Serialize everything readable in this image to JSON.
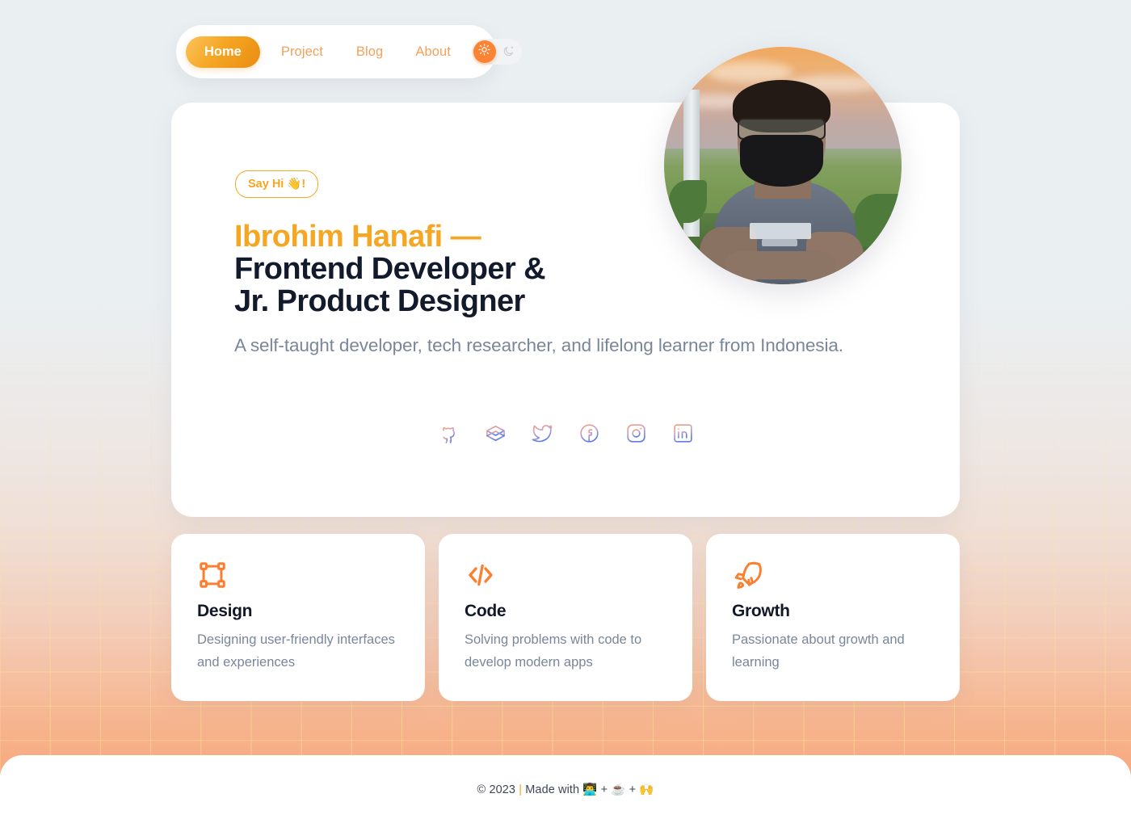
{
  "theme": {
    "accent_orange": "#f5a623",
    "accent_deep_orange": "#fb7f2e",
    "heading_dark": "#121a2b",
    "muted_text": "#7a8699",
    "card_white": "#ffffff",
    "bg_top": "#eaeff2",
    "bg_bottom": "#f9a173"
  },
  "nav": {
    "items": [
      {
        "label": "Home",
        "active": true
      },
      {
        "label": "Project",
        "active": false
      },
      {
        "label": "Blog",
        "active": false
      },
      {
        "label": "About",
        "active": false
      }
    ],
    "theme_toggle": {
      "state": "light",
      "light_icon": "sun-icon",
      "dark_icon": "moon-icon"
    }
  },
  "hero": {
    "badge": "Say Hi 👋!",
    "name": "Ibrohim Hanafi —",
    "role_line_1": "Frontend Developer &",
    "role_line_2": "Jr. Product Designer",
    "description": "A self-taught developer, tech researcher, and lifelong learner from Indonesia.",
    "avatar_alt": "portrait-photo",
    "socials": [
      {
        "name": "github-icon",
        "label": "GitHub"
      },
      {
        "name": "codepen-icon",
        "label": "Codepen"
      },
      {
        "name": "twitter-icon",
        "label": "Twitter"
      },
      {
        "name": "facebook-icon",
        "label": "Facebook"
      },
      {
        "name": "instagram-icon",
        "label": "Instagram"
      },
      {
        "name": "linkedin-icon",
        "label": "LinkedIn"
      }
    ]
  },
  "features": [
    {
      "icon": "frame-icon",
      "title": "Design",
      "description": "Designing user-friendly interfaces and experiences"
    },
    {
      "icon": "code-icon",
      "title": "Code",
      "description": "Solving problems with code to develop modern apps"
    },
    {
      "icon": "rocket-icon",
      "title": "Growth",
      "description": "Passionate about growth and learning"
    }
  ],
  "footer": {
    "copyright": "© 2023 ",
    "separator": "|",
    "made_with": " Made with 👨‍💻 + ☕ + 🙌"
  }
}
